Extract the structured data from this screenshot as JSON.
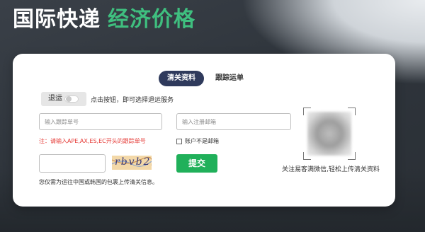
{
  "hero": {
    "title_white": "国际快递",
    "title_green": "经济价格"
  },
  "tabs": [
    {
      "label": "清关资料",
      "active": true
    },
    {
      "label": "跟踪运单",
      "active": false
    }
  ],
  "return_toggle": {
    "label": "退运",
    "hint": "点击按钮，即可选择退运服务",
    "on": false
  },
  "form": {
    "tracking_placeholder": "输入跟踪单号",
    "tracking_value": "",
    "email_placeholder": "输入注册邮箱",
    "email_value": "",
    "warning": "注：请输入APE,AX,ES,EC开头的跟踪单号",
    "checkbox_label": "账户不是邮箱",
    "checkbox_checked": false,
    "captcha_value": "",
    "captcha_text": "rbvb2",
    "submit_label": "提交",
    "note": "您仅需为运往中国或韩国的包裹上传清关信息。"
  },
  "qr": {
    "caption": "关注易客满微信,轻松上传清关资料"
  },
  "colors": {
    "brand_green": "#3fbf7f",
    "submit_green": "#20b05a",
    "tab_active": "#2f3a5c",
    "warning_red": "#e53935"
  }
}
